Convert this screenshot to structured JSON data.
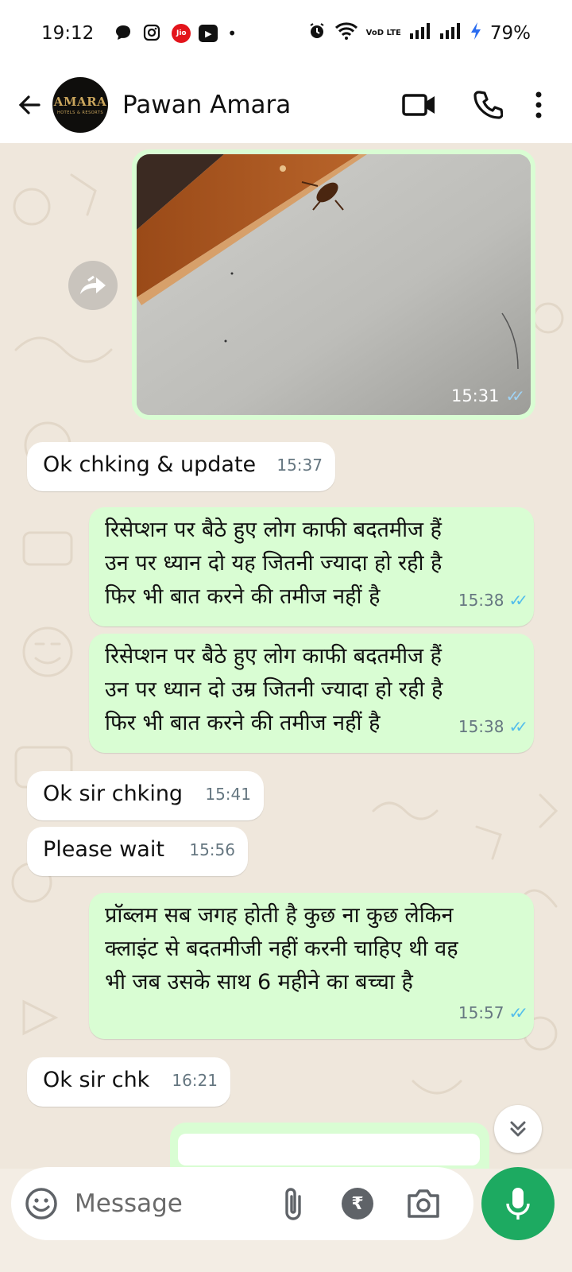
{
  "status_bar": {
    "time": "19:12",
    "jio_label": "Jio",
    "volte_label": "VoD LTE",
    "battery": "79%"
  },
  "header": {
    "contact_name": "Pawan Amara",
    "avatar_text": "AMARA",
    "avatar_subtext": "HOTELS & RESORTS"
  },
  "messages": [
    {
      "type": "image",
      "direction": "out",
      "time": "15:31",
      "read": true
    },
    {
      "direction": "in",
      "text": "Ok chking & update",
      "time": "15:37"
    },
    {
      "direction": "out",
      "lines": [
        "रिसेप्शन पर बैठे हुए लोग काफी बदतमीज हैं",
        "उन पर ध्यान दो यह जितनी ज्यादा हो रही है",
        "फिर भी बात करने की तमीज नहीं है"
      ],
      "time": "15:38",
      "read": true
    },
    {
      "direction": "out",
      "lines": [
        "रिसेप्शन पर बैठे हुए लोग काफी बदतमीज हैं",
        "उन पर ध्यान दो उम्र जितनी ज्यादा हो रही है",
        "फिर भी बात करने की तमीज नहीं है"
      ],
      "time": "15:38",
      "read": true
    },
    {
      "direction": "in",
      "text": "Ok sir chking",
      "time": "15:41"
    },
    {
      "direction": "in",
      "text": "Please wait",
      "time": "15:56"
    },
    {
      "direction": "out",
      "lines": [
        "प्रॉब्लम सब जगह होती है कुछ ना कुछ लेकिन",
        "क्लाइंट से बदतमीजी नहीं करनी चाहिए थी वह",
        "भी जब उसके साथ 6 महीने का बच्चा है"
      ],
      "time": "15:57",
      "read": true
    },
    {
      "direction": "in",
      "text": "Ok sir chk",
      "time": "16:21"
    }
  ],
  "composer": {
    "placeholder": "Message",
    "rupee_symbol": "₹"
  },
  "colors": {
    "outgoing_bubble": "#d9fdd3",
    "incoming_bubble": "#ffffff",
    "accent_green": "#1daa61",
    "read_ticks": "#53bdeb",
    "wallpaper": "#efe7dc"
  }
}
